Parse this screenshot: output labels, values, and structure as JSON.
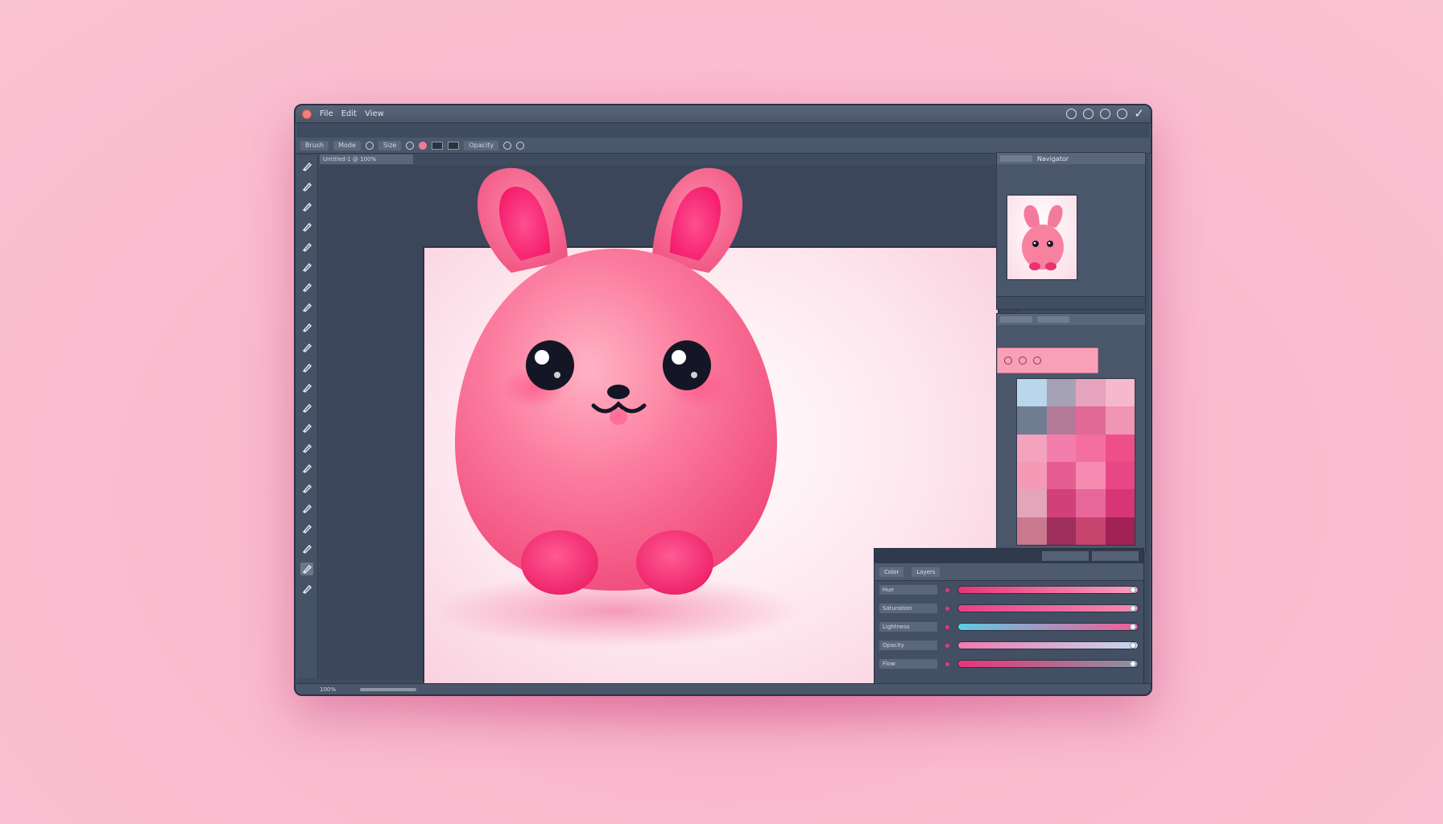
{
  "window": {
    "title_menu": [
      "File",
      "Edit",
      "View"
    ],
    "options_bar": [
      "Brush",
      "Mode",
      "Size",
      "Opacity"
    ],
    "doc_tab": "Untitled-1 @ 100%"
  },
  "tools": [
    "move-icon",
    "marquee-icon",
    "lasso-icon",
    "quick-select-icon",
    "crop-icon",
    "eyedropper-icon",
    "healing-icon",
    "brush-icon",
    "clone-stamp-icon",
    "history-brush-icon",
    "eraser-icon",
    "gradient-icon",
    "blur-icon",
    "dodge-icon",
    "pen-icon",
    "type-icon",
    "path-select-icon",
    "shape-icon",
    "hand-icon",
    "zoom-icon",
    "foreground-color-icon",
    "quick-mask-icon"
  ],
  "status": {
    "zoom": "100%"
  },
  "navigator": {
    "tab_label": "Navigator"
  },
  "swatches": {
    "colors": [
      "#b9d6ea",
      "#a6a2b6",
      "#e5a3bd",
      "#f6b9cc",
      "#707d90",
      "#b27a97",
      "#e06a95",
      "#f095b2",
      "#f3a3be",
      "#f47eab",
      "#f46fa0",
      "#ee4f89",
      "#f49ab6",
      "#e65d93",
      "#f58bb0",
      "#e84785",
      "#e2a5b9",
      "#d2407a",
      "#e7679b",
      "#d83577",
      "#c9798d",
      "#9e2f5d",
      "#c7446f",
      "#a12154"
    ]
  },
  "adjust": {
    "tabs": [
      "Color",
      "Layers"
    ],
    "rows": [
      {
        "label": "Hue",
        "colors": [
          "#e8357a",
          "#f7a0bc"
        ]
      },
      {
        "label": "Saturation",
        "colors": [
          "#ec3f86",
          "#f38bb2"
        ]
      },
      {
        "label": "Lightness",
        "colors": [
          "#5ecbe3",
          "#f05c98"
        ]
      },
      {
        "label": "Opacity",
        "colors": [
          "#f07bb0",
          "#c6d8ec"
        ]
      },
      {
        "label": "Flow",
        "colors": [
          "#e8357a",
          "#8a93a2"
        ]
      }
    ]
  }
}
